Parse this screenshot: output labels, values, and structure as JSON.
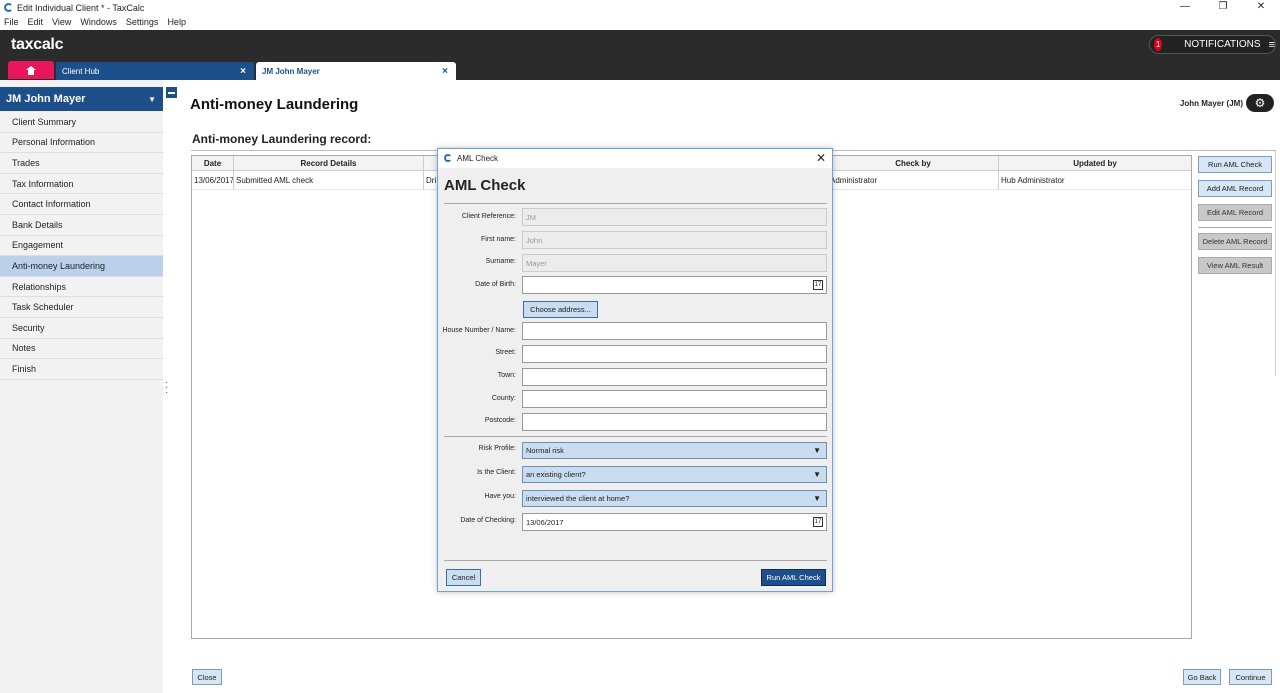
{
  "window": {
    "title": "Edit Individual Client * - TaxCalc",
    "minimize": "—",
    "restore": "❐",
    "close": "✕"
  },
  "menu": [
    "File",
    "Edit",
    "View",
    "Windows",
    "Settings",
    "Help"
  ],
  "header": {
    "logo": "taxcalc",
    "notifications_count": "1",
    "notifications_label": "NOTIFICATIONS",
    "menu_icon": "≡"
  },
  "tabs": {
    "hub": "Client Hub",
    "client": "JM John Mayer",
    "close": "×"
  },
  "sidebar": {
    "client_name": "JM John  Mayer",
    "chevron": "▼",
    "items": [
      {
        "label": "Client Summary"
      },
      {
        "label": "Personal Information"
      },
      {
        "label": "Trades"
      },
      {
        "label": "Tax Information"
      },
      {
        "label": "Contact Information"
      },
      {
        "label": "Bank Details"
      },
      {
        "label": "Engagement"
      },
      {
        "label": "Anti-money Laundering"
      },
      {
        "label": "Relationships"
      },
      {
        "label": "Task Scheduler"
      },
      {
        "label": "Security"
      },
      {
        "label": "Notes"
      },
      {
        "label": "Finish"
      }
    ],
    "active_index": 7
  },
  "main": {
    "title": "Anti-money Laundering",
    "user": "John Mayer (JM)",
    "gear": "⚙",
    "section_title": "Anti-money Laundering record:",
    "table": {
      "headers": [
        "Date",
        "Record Details",
        "",
        "",
        "Check by",
        "Updated by"
      ],
      "rows": [
        [
          "13/06/2017",
          "Submitted AML check",
          "Dri",
          "",
          "Administrator",
          "Hub Administrator"
        ]
      ]
    },
    "buttons": {
      "run": "Run AML Check",
      "add": "Add AML Record",
      "edit": "Edit AML Record",
      "delete": "Delete AML Record",
      "view": "View AML Result"
    },
    "close": "Close",
    "go_back": "Go Back",
    "continue": "Continue"
  },
  "modal": {
    "window_title": "AML Check",
    "close": "✕",
    "heading": "AML Check",
    "labels": {
      "client_ref": "Client Reference:",
      "first_name": "First name:",
      "surname": "Surname:",
      "dob": "Date of Birth:",
      "house": "House Number / Name:",
      "street": "Street:",
      "town": "Town:",
      "county": "County:",
      "postcode": "Postcode:",
      "risk": "Risk Profile:",
      "is_client": "Is the Client:",
      "have_you": "Have you:",
      "date_checking": "Date of Checking:"
    },
    "values": {
      "client_ref": "JM",
      "first_name": "John",
      "surname": "Mayer",
      "dob": "",
      "house": "",
      "street": "",
      "town": "",
      "county": "",
      "postcode": "",
      "risk": "Normal risk",
      "is_client": "an existing client?",
      "have_you": "interviewed the client at home?",
      "date_checking": "13/06/2017"
    },
    "calendar_glyph": "17",
    "select_arrow": "▼",
    "choose_address": "Choose address...",
    "cancel": "Cancel",
    "run": "Run AML Check"
  }
}
